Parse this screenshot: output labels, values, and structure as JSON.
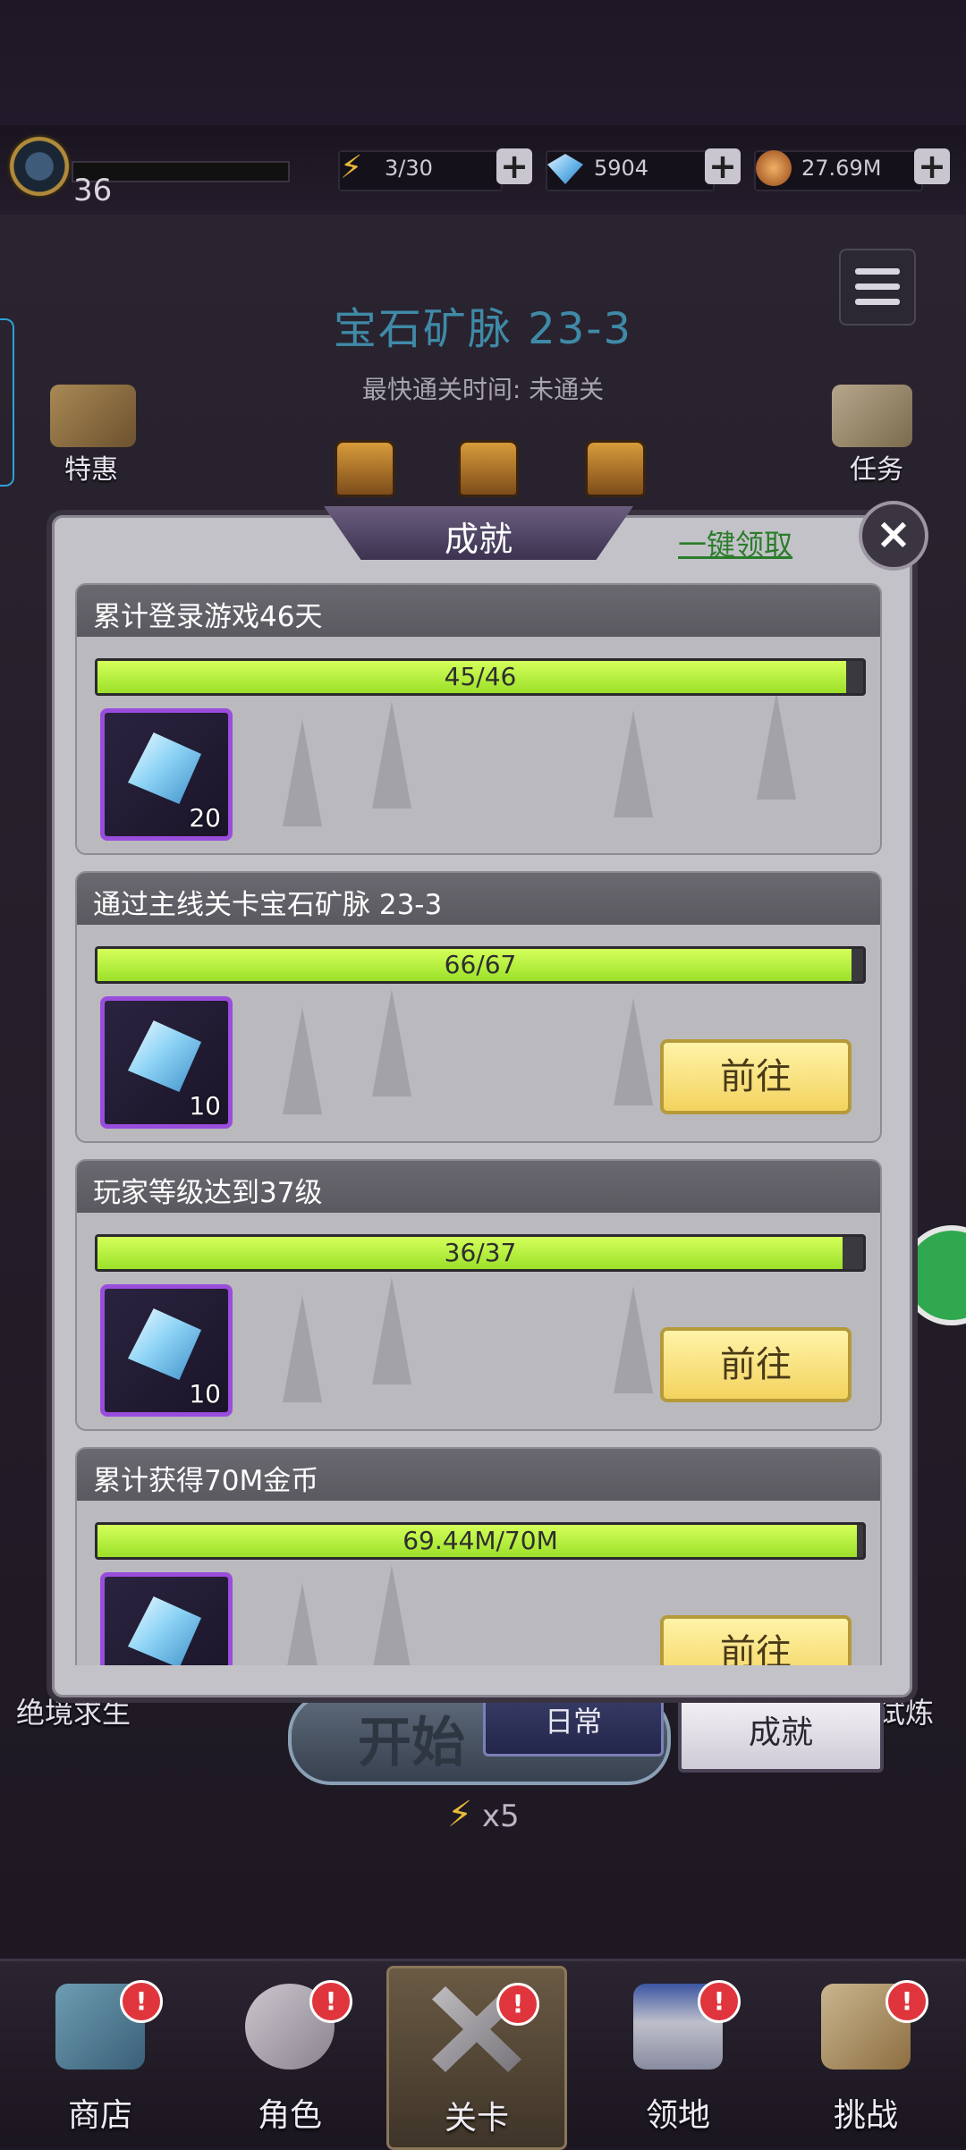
{
  "topbar": {
    "level": "36",
    "energy": "3/30",
    "gems": "5904",
    "gold": "27.69M",
    "plus": "+"
  },
  "stage": {
    "title": "宝石矿脉 23-3",
    "fastest_clear": "最快通关时间:  未通关",
    "left_side_label": "特惠",
    "right_side_label": "任务",
    "bottom_left_label": "绝境求生",
    "bottom_right_label": "试炼",
    "start_label": "开始",
    "energy_cost": "x5",
    "tabs": {
      "daily": "日常",
      "achievement": "成就"
    }
  },
  "modal": {
    "title": "成就",
    "claim_all": "一键领取",
    "close": "×",
    "go_label": "前往",
    "achievements": [
      {
        "title": "累计登录游戏46天",
        "progress_text": "45/46",
        "progress": 0.978,
        "reward_count": "20",
        "has_go": false
      },
      {
        "title": "通过主线关卡宝石矿脉 23-3",
        "progress_text": "66/67",
        "progress": 0.985,
        "reward_count": "10",
        "has_go": true
      },
      {
        "title": "玩家等级达到37级",
        "progress_text": "36/37",
        "progress": 0.973,
        "reward_count": "10",
        "has_go": true
      },
      {
        "title": "累计获得70M金币",
        "progress_text": "69.44M/70M",
        "progress": 0.992,
        "reward_count": "",
        "has_go": true
      }
    ]
  },
  "nav": [
    {
      "label": "商店",
      "badge": "!"
    },
    {
      "label": "角色",
      "badge": "!"
    },
    {
      "label": "关卡",
      "badge": "!"
    },
    {
      "label": "领地",
      "badge": "!"
    },
    {
      "label": "挑战",
      "badge": "!"
    }
  ],
  "icons": {
    "energy": "lightning-icon",
    "gem": "diamond-icon",
    "gold": "coin-icon",
    "menu": "list-menu-icon",
    "close": "close-icon",
    "chat": "wechat-icon"
  },
  "colors": {
    "progress_fill": "#a8e83a",
    "reward_border": "#9a4ddc",
    "go_button": "#f3d35e",
    "claim_all": "#2b7d2b"
  }
}
